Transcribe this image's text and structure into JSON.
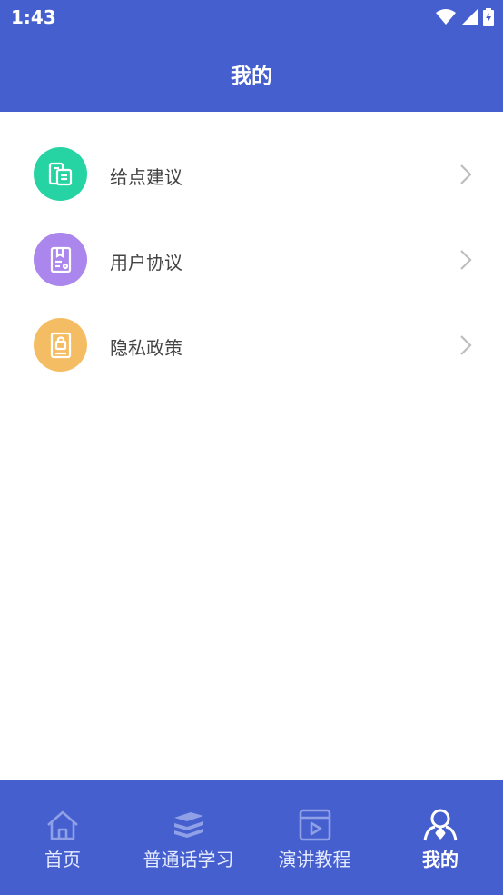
{
  "status_bar": {
    "time": "1:43"
  },
  "header": {
    "title": "我的"
  },
  "menu": {
    "items": [
      {
        "label": "给点建议",
        "icon": "feedback-icon",
        "color": "#26d4a3"
      },
      {
        "label": "用户协议",
        "icon": "agreement-icon",
        "color": "#ab86ec"
      },
      {
        "label": "隐私政策",
        "icon": "privacy-lock-icon",
        "color": "#f5bd63"
      }
    ]
  },
  "bottom_nav": {
    "items": [
      {
        "label": "首页",
        "icon": "home-icon",
        "active": false
      },
      {
        "label": "普通话学习",
        "icon": "books-icon",
        "active": false
      },
      {
        "label": "演讲教程",
        "icon": "video-tutorial-icon",
        "active": false
      },
      {
        "label": "我的",
        "icon": "profile-icon",
        "active": true
      }
    ]
  },
  "colors": {
    "primary": "#455fcf"
  }
}
